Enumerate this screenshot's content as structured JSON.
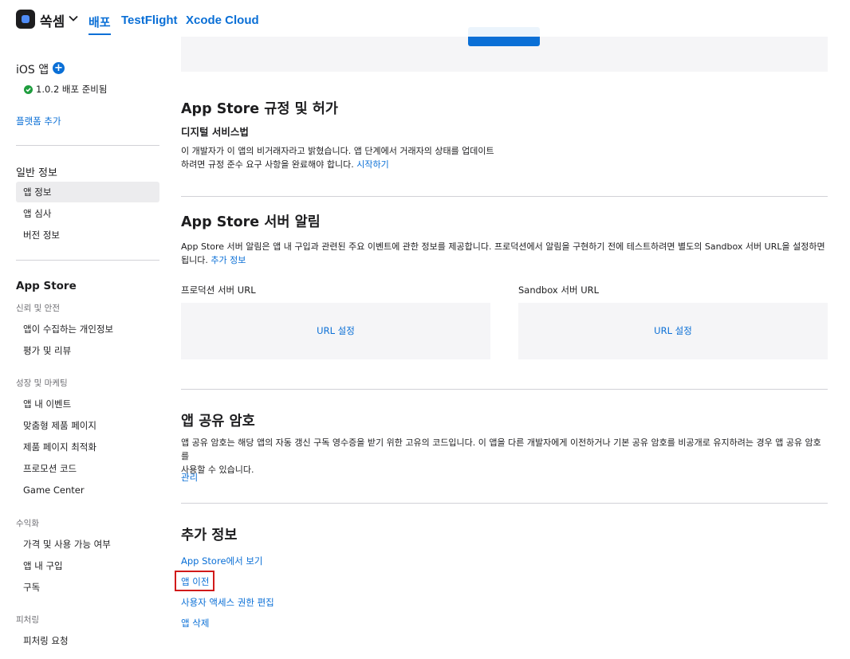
{
  "topbar": {
    "app_name": "쏙셈",
    "nav": [
      "배포",
      "TestFlight",
      "Xcode Cloud"
    ]
  },
  "sidebar": {
    "ios_title": "iOS 앱",
    "version_status": "1.0.2 배포 준비됨",
    "add_platform": "플랫폼 추가",
    "general_title": "일반 정보",
    "general_items": [
      "앱 정보",
      "앱 심사",
      "버전 정보"
    ],
    "appstore_title": "App Store",
    "groups": [
      {
        "name": "신뢰 및 안전",
        "items": [
          "앱이 수집하는 개인정보",
          "평가 및 리뷰"
        ]
      },
      {
        "name": "성장 및 마케팅",
        "items": [
          "앱 내 이벤트",
          "맞춤형 제품 페이지",
          "제품 페이지 최적화",
          "프로모션 코드",
          "Game Center"
        ]
      },
      {
        "name": "수익화",
        "items": [
          "가격 및 사용 가능 여부",
          "앱 내 구입",
          "구독"
        ]
      },
      {
        "name": "피처링",
        "items": [
          "피처링 요청"
        ]
      }
    ]
  },
  "main": {
    "regulations": {
      "title": "App Store 규정 및 허가",
      "subtitle": "디지털 서비스법",
      "text_line1": "이 개발자가 이 앱의 비거래자라고 밝혔습니다. 앱 단계에서 거래자의 상태를 업데이트",
      "text_line2": "하려면 규정 준수 요구 사항을 완료해야 합니다.",
      "link": "시작하기"
    },
    "server_notifications": {
      "title": "App Store 서버 알림",
      "text_line1": "App Store 서버 알림은 앱 내 구입과 관련된 주요 이벤트에 관한 정보를 제공합니다. 프로덕션에서 알림을 구현하기 전에 테스트하려면 별도의 Sandbox 서버 URL을 설정하면",
      "text_line2": "됩니다.",
      "link": "추가 정보",
      "production_label": "프로덕션 서버 URL",
      "sandbox_label": "Sandbox 서버 URL",
      "set_url": "URL 설정"
    },
    "shared_secret": {
      "title": "앱 공유 암호",
      "text_line1": "앱 공유 암호는 해당 앱의 자동 갱신 구독 영수증을 받기 위한 고유의 코드입니다. 이 앱을 다른 개발자에게 이전하거나 기본 공유 암호를 비공개로 유지하려는 경우 앱 공유 암호를",
      "text_line2": "사용할 수 있습니다.",
      "manage": "관리"
    },
    "additional_info": {
      "title": "추가 정보",
      "links": [
        "App Store에서 보기",
        "앱 이전",
        "사용자 액세스 권한 편집",
        "앱 삭제"
      ]
    }
  },
  "colors": {
    "accent": "#0a6fd6",
    "highlight": "#d11a1a",
    "success": "#1f9d3e"
  }
}
